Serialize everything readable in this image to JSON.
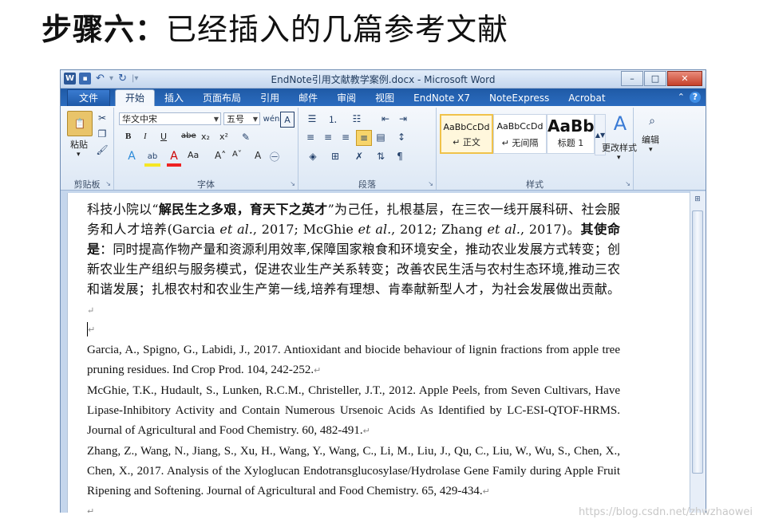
{
  "slide": {
    "title_step": "步骤六：",
    "title_text": "已经插入的几篇参考文献"
  },
  "window": {
    "title": "EndNote引用文献教学案例.docx - Microsoft Word",
    "controls": {
      "minimize": "–",
      "maximize": "□",
      "close": "✕"
    }
  },
  "tabs": {
    "file": "文件",
    "items": [
      "开始",
      "插入",
      "页面布局",
      "引用",
      "邮件",
      "审阅",
      "视图",
      "EndNote X7",
      "NoteExpress",
      "Acrobat"
    ],
    "active": "开始"
  },
  "ribbon": {
    "clipboard": {
      "paste": "粘贴",
      "label": "剪贴板"
    },
    "font": {
      "font_name": "华文中宋",
      "font_size": "五号",
      "label": "字体",
      "bold": "B",
      "italic": "I",
      "underline": "U",
      "strike": "abe",
      "sub": "x₂",
      "sup": "x²",
      "grow": "A˄",
      "shrink": "A˅",
      "case": "Aa",
      "clear": "A"
    },
    "paragraph": {
      "label": "段落"
    },
    "styles": {
      "label": "样式",
      "items": [
        {
          "sample": "AaBbCcDd",
          "name": "↵ 正文"
        },
        {
          "sample": "AaBbCcDd",
          "name": "↵ 无间隔"
        },
        {
          "sample": "AaBb",
          "name": "标题 1"
        }
      ],
      "change_styles": "更改样式"
    },
    "editing": {
      "label": "编辑"
    }
  },
  "document": {
    "paragraph": {
      "s1": "科技小院以“",
      "s1_bold": "解民生之多艰，育天下之英才",
      "s2": "”为己任，扎根基层，在三农一线开展科研、社会服务和人才培养(Garcia ",
      "etal1": "et al.",
      "s3": ", 2017; McGhie ",
      "etal2": "et al.",
      "s4": ", 2012; Zhang ",
      "etal3": "et al.",
      "s5": ", 2017)。",
      "mission_bold": "其使命是",
      "s6": "：同时提高作物产量和资源利用效率,保障国家粮食和环境安全，推动农业发展方式转变；创新农业生产组织与服务模式，促进农业生产关系转变；改善农民生活与农村生态环境,推动三农和谐发展；扎根农村和农业生产第一线,培养有理想、肯奉献新型人才，为社会发展做出贡献。"
    },
    "para_mark": "↵",
    "references": [
      "Garcia, A., Spigno, G., Labidi, J., 2017. Antioxidant and biocide behaviour of lignin fractions from apple tree pruning residues. Ind Crop Prod. 104, 242-252.",
      "McGhie, T.K., Hudault, S., Lunken, R.C.M., Christeller, J.T., 2012. Apple Peels, from Seven Cultivars, Have Lipase-Inhibitory Activity and Contain Numerous Ursenoic Acids As Identified by LC-ESI-QTOF-HRMS.  Journal of Agricultural and Food Chemistry. 60, 482-491.",
      "Zhang, Z., Wang, N., Jiang, S., Xu, H., Wang, Y., Wang, C., Li, M., Liu, J., Qu, C., Liu, W., Wu, S., Chen, X., Chen, X., 2017. Analysis of the Xyloglucan Endotransglucosylase/Hydrolase Gene Family during Apple Fruit Ripening and Softening. Journal of Agricultural and Food Chemistry. 65, 429-434."
    ]
  },
  "watermark": "https://blog.csdn.net/zhwzhaowei"
}
